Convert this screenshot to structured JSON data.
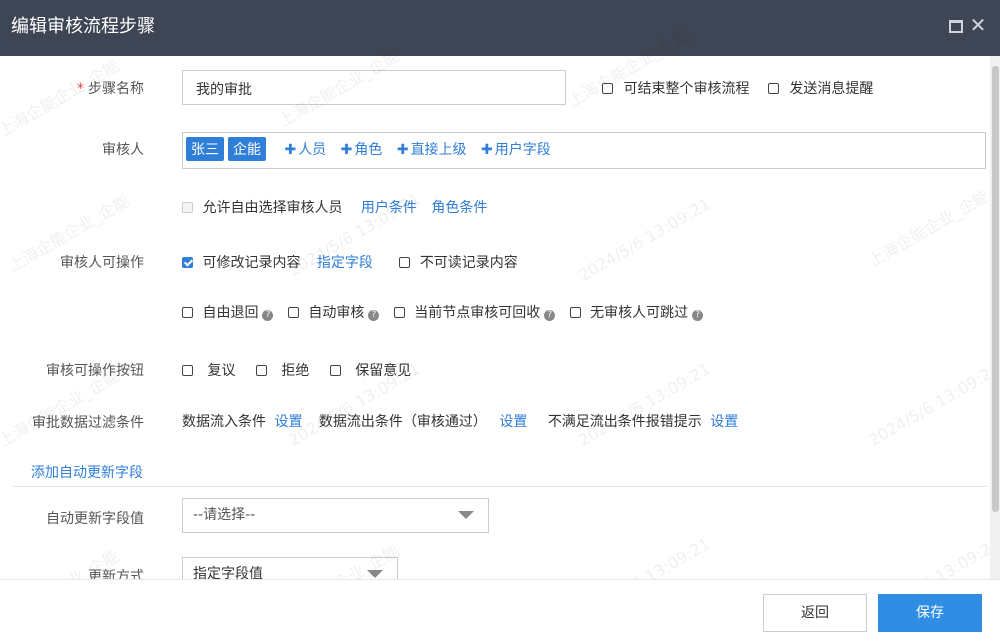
{
  "dialog": {
    "title": "编辑审核流程步骤"
  },
  "step_name": {
    "label": "步骤名称",
    "value": "我的审批",
    "can_end_flow_label": "可结束整个审核流程",
    "send_notify_label": "发送消息提醒"
  },
  "reviewers": {
    "label": "审核人",
    "tags": [
      "张三",
      "企能"
    ],
    "add_person": "人员",
    "add_role": "角色",
    "add_superior": "直接上级",
    "add_user_field": "用户字段",
    "allow_free_choice_label": "允许自由选择审核人员",
    "user_condition": "用户条件",
    "role_condition": "角色条件"
  },
  "reviewer_ops": {
    "label": "审核人可操作",
    "can_edit_label": "可修改记录内容",
    "specify_field": "指定字段",
    "unreadable_label": "不可读记录内容",
    "free_return_label": "自由退回",
    "auto_review_label": "自动审核",
    "recyclable_label": "当前节点审核可回收",
    "skip_label": "无审核人可跳过"
  },
  "op_buttons": {
    "label": "审核可操作按钮",
    "reconsider": "复议",
    "reject": "拒绝",
    "keep_opinion": "保留意见"
  },
  "filter": {
    "label": "审批数据过滤条件",
    "inflow": "数据流入条件",
    "outflow": "数据流出条件（审核通过）",
    "not_met": "不满足流出条件报错提示",
    "set": "设置"
  },
  "auto_update": {
    "add_link": "添加自动更新字段",
    "field_value_label": "自动更新字段值",
    "field_value_placeholder": "--请选择--",
    "mode_label": "更新方式",
    "mode_value": "指定字段值"
  },
  "footer": {
    "back": "返回",
    "save": "保存"
  },
  "watermark": {
    "company": "上海企能企业_企能",
    "timestamp": "2024/5/6 13:09:21"
  },
  "icons": {
    "maximize": "maximize-icon",
    "close": "close-icon",
    "help": "help-icon",
    "plus": "plus-icon",
    "caret": "caret-down-icon"
  },
  "colors": {
    "titlebar": "#3e4554",
    "accent": "#2f7ed8",
    "save": "#2f8de4"
  }
}
